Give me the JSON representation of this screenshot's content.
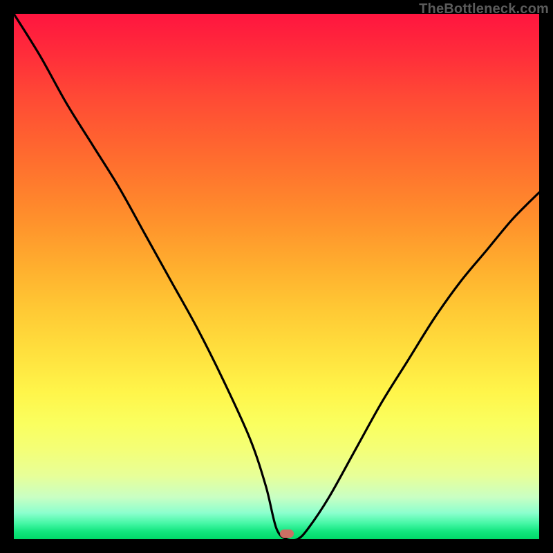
{
  "watermark": "TheBottleneck.com",
  "marker": {
    "x_pct": 52,
    "y_pct": 99
  },
  "chart_data": {
    "type": "line",
    "title": "",
    "xlabel": "",
    "ylabel": "",
    "xlim": [
      0,
      100
    ],
    "ylim": [
      0,
      100
    ],
    "series": [
      {
        "name": "bottleneck-curve",
        "x": [
          0,
          5,
          10,
          15,
          20,
          25,
          30,
          35,
          40,
          45,
          48,
          50,
          52,
          54,
          56,
          60,
          65,
          70,
          75,
          80,
          85,
          90,
          95,
          100
        ],
        "y": [
          100,
          92,
          83,
          75,
          67,
          58,
          49,
          40,
          30,
          19,
          10,
          2,
          0,
          0,
          2,
          8,
          17,
          26,
          34,
          42,
          49,
          55,
          61,
          66
        ]
      }
    ],
    "annotations": []
  }
}
